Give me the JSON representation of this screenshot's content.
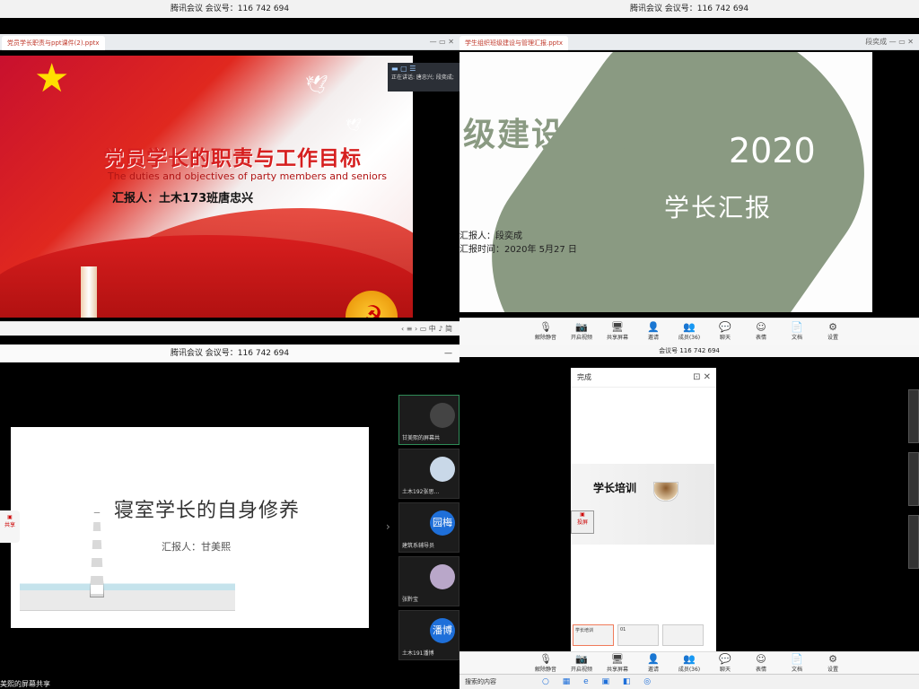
{
  "meeting": {
    "title": "腾讯会议  会议号：116 742 694",
    "small_id": "会议号 116 742 694"
  },
  "tl": {
    "tab_label": "党员学长职责与ppt课件(2).pptx",
    "float_label": "正在讲话: 唐忠兴; 段奕成;",
    "slide_title": "党员学长的职责与工作目标",
    "slide_subtitle": "The duties and objectives of party members and seniors",
    "slide_reporter": "汇报人：土木173班唐忠兴",
    "nav_text": "‹  ≡  ›  ▭  中 ♪ 简"
  },
  "tr": {
    "tab_label": "学生组织班级建设与管理汇报.pptx",
    "user": "段奕成",
    "slide_title": "级建设与管理",
    "year": "2020",
    "subtitle": "学长汇报",
    "reporter": "汇报人：段奕成",
    "time": "汇报时间：2020年 5月27 日",
    "toolbar": [
      {
        "icon": "mic",
        "label": "解除静音"
      },
      {
        "icon": "camera",
        "label": "开启视频"
      },
      {
        "icon": "screen",
        "label": "共享屏幕"
      },
      {
        "icon": "invite",
        "label": "邀请"
      },
      {
        "icon": "members",
        "label": "成员(36)"
      },
      {
        "icon": "chat",
        "label": "聊天"
      },
      {
        "icon": "emoji",
        "label": "表情"
      },
      {
        "icon": "doc",
        "label": "文档"
      },
      {
        "icon": "settings",
        "label": "设置"
      }
    ]
  },
  "bl": {
    "slide_title": "寝室学长的自身修养",
    "reporter": "汇报人：甘美熙",
    "bottom_text": "美熙的屏幕共享",
    "left_chip": "共享",
    "participants": [
      {
        "name": "甘美熙的屏幕共",
        "avatar": ""
      },
      {
        "name": "土木192张思…",
        "avatar": ""
      },
      {
        "name": "建筑系辅导员",
        "avatar": "园梅"
      },
      {
        "name": "张黔宝",
        "avatar": ""
      },
      {
        "name": "土木191潘博",
        "avatar": "潘博"
      }
    ]
  },
  "br": {
    "done": "完成",
    "slide_title": "学长培训",
    "thumb1": "学长培训",
    "thumb2": "01",
    "chip_text": "投屏",
    "taskbar_text": "搜索的内容",
    "toolbar": [
      {
        "icon": "mic",
        "label": "解除静音"
      },
      {
        "icon": "camera",
        "label": "开启视频"
      },
      {
        "icon": "screen",
        "label": "共享屏幕"
      },
      {
        "icon": "invite",
        "label": "邀请"
      },
      {
        "icon": "members",
        "label": "成员(36)"
      },
      {
        "icon": "chat",
        "label": "聊天"
      },
      {
        "icon": "emoji",
        "label": "表情"
      },
      {
        "icon": "doc",
        "label": "文档"
      },
      {
        "icon": "settings",
        "label": "设置"
      }
    ]
  },
  "colors": {
    "party_red": "#d61f1f",
    "sage_green": "#8a9a82",
    "meeting_blue": "#1e6fd9"
  }
}
